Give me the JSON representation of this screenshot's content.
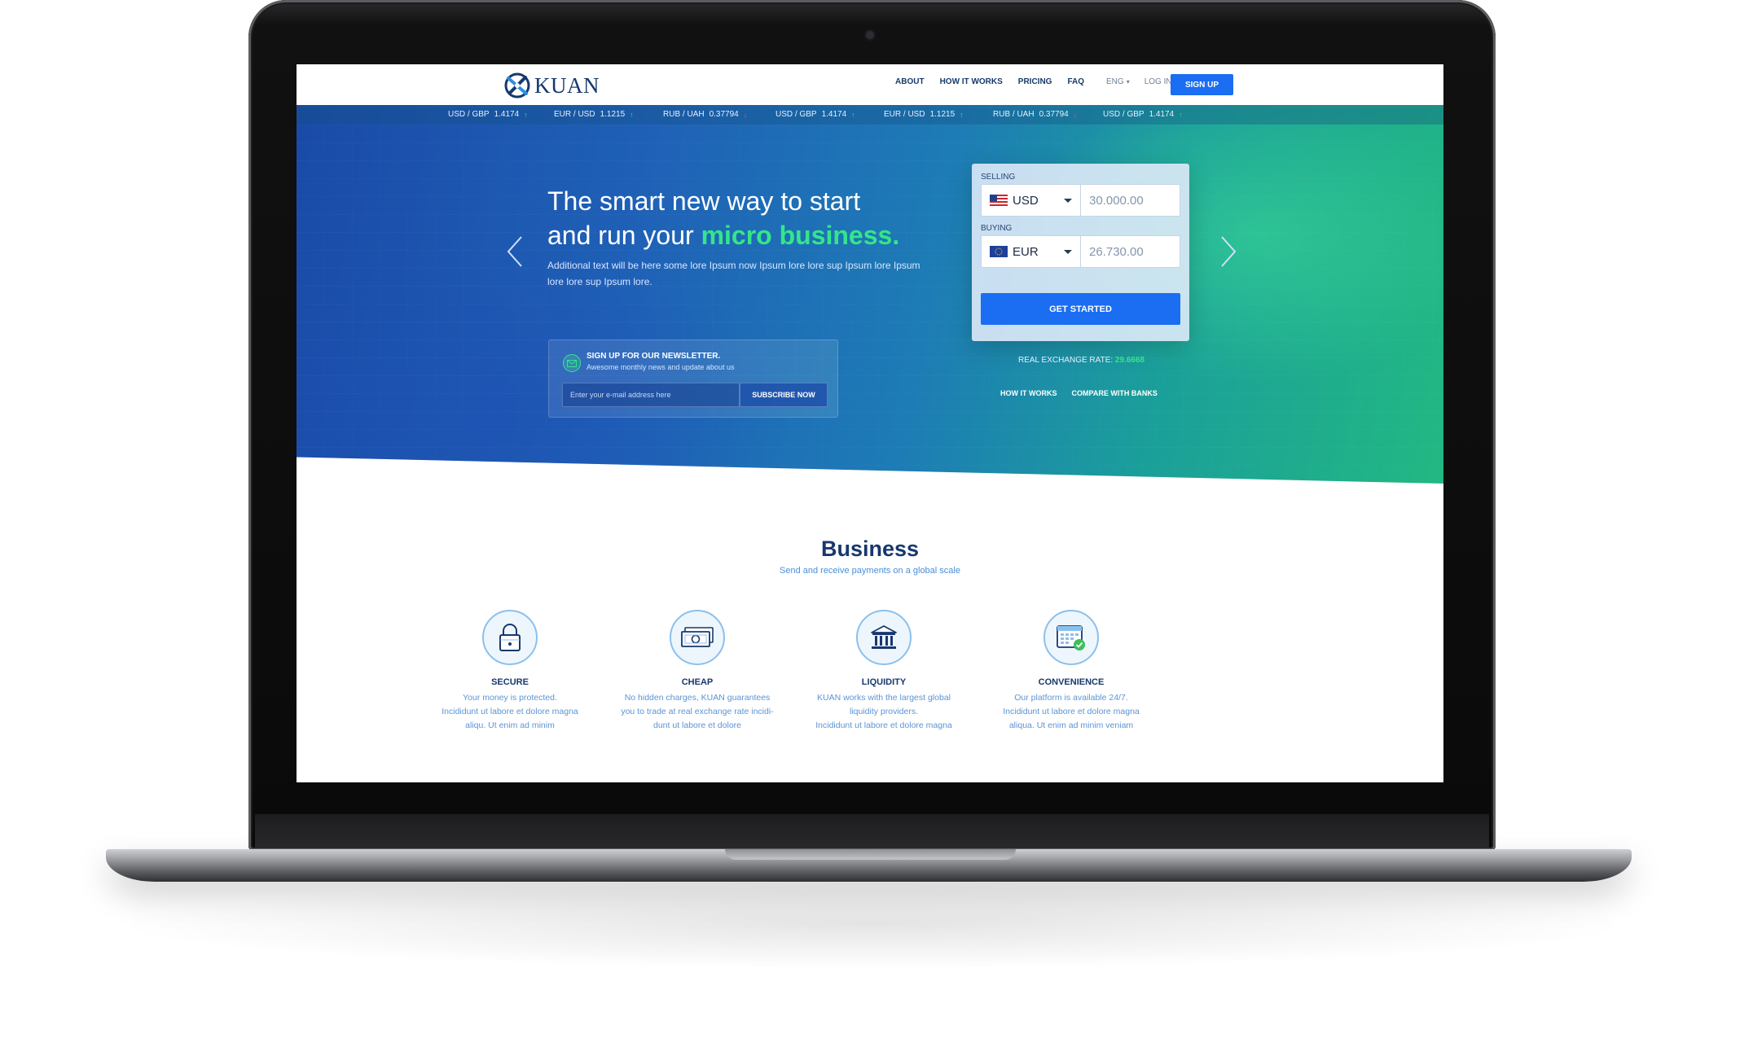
{
  "nav": {
    "logo_text": "KUAN",
    "links": [
      "ABOUT",
      "HOW IT WORKS",
      "PRICING",
      "FAQ"
    ],
    "language": "ENG",
    "login": "LOG IN",
    "signup": "SIGN UP"
  },
  "ticker": [
    {
      "pair": "USD / GBP",
      "value": "1.4174",
      "trend": "up"
    },
    {
      "pair": "EUR / USD",
      "value": "1.1215",
      "trend": "up"
    },
    {
      "pair": "RUB / UAH",
      "value": "0.37794",
      "trend": "down"
    },
    {
      "pair": "USD / GBP",
      "value": "1.4174",
      "trend": "up"
    },
    {
      "pair": "EUR / USD",
      "value": "1.1215",
      "trend": "up"
    },
    {
      "pair": "RUB / UAH",
      "value": "0.37794",
      "trend": "down"
    },
    {
      "pair": "USD / GBP",
      "value": "1.4174",
      "trend": "up"
    }
  ],
  "hero": {
    "title_line1": "The smart new way to start",
    "title_line2_prefix": "and run your ",
    "title_highlight": "micro business.",
    "subtitle": "Additional text will be here some lore Ipsum now Ipsum lore lore sup Ipsum lore Ipsum lore lore sup Ipsum lore."
  },
  "newsletter": {
    "title": "SIGN UP FOR OUR NEWSLETTER.",
    "description": "Awesome monthly news and update about us",
    "placeholder": "Enter your e-mail address here",
    "button": "SUBSCRIBE NOW"
  },
  "converter": {
    "selling_label": "SELLING",
    "selling_currency": "USD",
    "selling_amount": "30.000.00",
    "buying_label": "BUYING",
    "buying_currency": "EUR",
    "buying_amount": "26.730.00",
    "button": "GET STARTED",
    "rate_label": "REAL EXCHANGE RATE:",
    "rate_value": "29.6668",
    "link_how": "HOW IT WORKS",
    "link_compare": "COMPARE WITH BANKS"
  },
  "business": {
    "title": "Business",
    "subtitle": "Send and receive payments on a global scale",
    "features": [
      {
        "title": "SECURE",
        "icon": "lock-icon",
        "lines": [
          "Your money is protected.",
          "Incididunt ut labore et dolore magna",
          "aliqu. Ut enim ad minim"
        ]
      },
      {
        "title": "CHEAP",
        "icon": "money-icon",
        "lines": [
          "No hidden charges, KUAN guarantees",
          "you to trade at real exchange rate incidi-",
          "dunt ut labore et dolore"
        ]
      },
      {
        "title": "LIQUIDITY",
        "icon": "bank-icon",
        "lines": [
          "KUAN works with the largest global",
          "liquidity providers.",
          "Incididunt ut labore et dolore magna"
        ]
      },
      {
        "title": "CONVENIENCE",
        "icon": "calendar-check-icon",
        "lines": [
          "Our platform is available 24/7.",
          "Incididunt ut labore et dolore magna",
          "aliqua. Ut enim ad minim veniam"
        ]
      }
    ]
  },
  "colors": {
    "primary": "#1b6df2",
    "navy": "#17386e",
    "accent_green": "#35e58a",
    "link_blue": "#5b94d6"
  }
}
